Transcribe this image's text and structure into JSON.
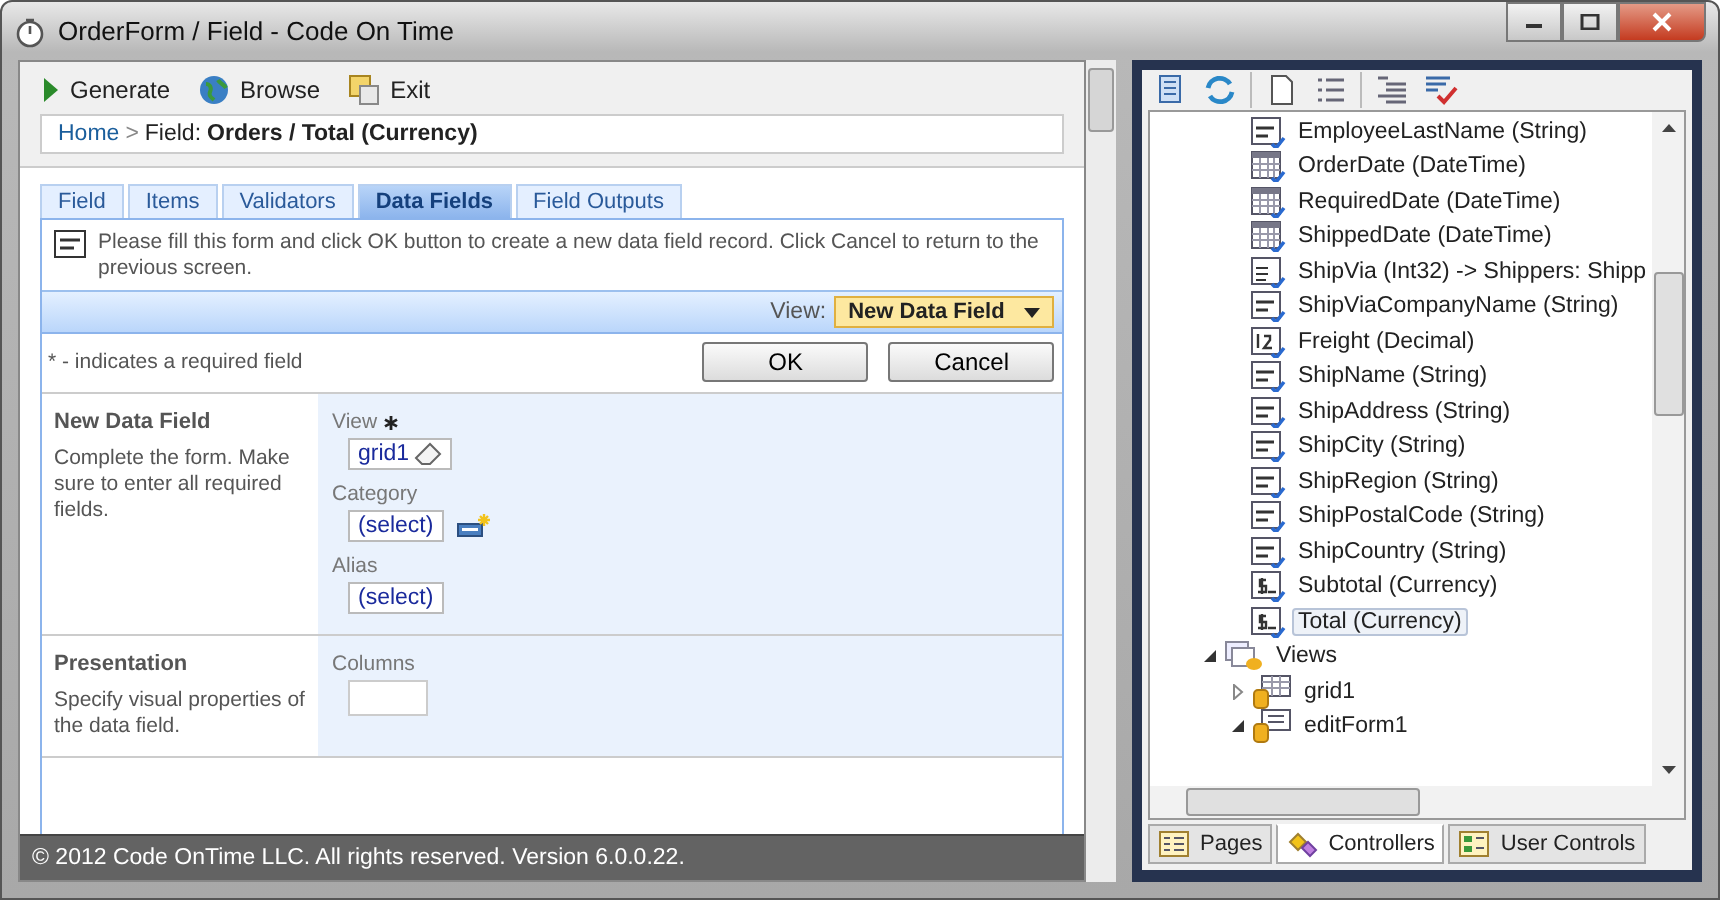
{
  "window": {
    "title": "OrderForm / Field - Code On Time"
  },
  "toolbar": [
    {
      "label": "Generate",
      "kind": "play"
    },
    {
      "label": "Browse",
      "kind": "globe"
    },
    {
      "label": "Exit",
      "kind": "exit"
    }
  ],
  "breadcrumb": {
    "link": "Home",
    "separator": ">",
    "prefix": "Field:",
    "value": "Orders / Total (Currency)"
  },
  "tabs": [
    {
      "label": "Field",
      "selected": false
    },
    {
      "label": "Items",
      "selected": false
    },
    {
      "label": "Validators",
      "selected": false
    },
    {
      "label": "Data Fields",
      "selected": true
    },
    {
      "label": "Field Outputs",
      "selected": false
    }
  ],
  "notice": "Please fill this form and click OK button to create a new data field record. Click Cancel to return to the previous screen.",
  "view_bar": {
    "label": "View:",
    "value": "New Data Field"
  },
  "required_note": "* - indicates a required field",
  "buttons": [
    "OK",
    "Cancel"
  ],
  "sections": [
    {
      "title": "New Data Field",
      "description": "Complete the form. Make sure to enter all required fields.",
      "fields": [
        {
          "label": "View",
          "required": true,
          "kind": "lookup",
          "value": "grid1",
          "clearable": true,
          "creatable": false
        },
        {
          "label": "Category",
          "required": false,
          "kind": "lookup",
          "value": "(select)",
          "clearable": false,
          "creatable": true
        },
        {
          "label": "Alias",
          "required": false,
          "kind": "lookup",
          "value": "(select)",
          "clearable": false,
          "creatable": false
        }
      ]
    },
    {
      "title": "Presentation",
      "description": "Specify visual properties of the data field.",
      "fields": [
        {
          "label": "Columns",
          "required": false,
          "kind": "input"
        }
      ]
    }
  ],
  "footer": "© 2012 Code OnTime LLC. All rights reserved. Version 6.0.0.22.",
  "explorer": {
    "fields": [
      {
        "label": "EmployeeLastName (String)",
        "kind": "string",
        "selected": false
      },
      {
        "label": "OrderDate (DateTime)",
        "kind": "date",
        "selected": false
      },
      {
        "label": "RequiredDate (DateTime)",
        "kind": "date",
        "selected": false
      },
      {
        "label": "ShippedDate (DateTime)",
        "kind": "date",
        "selected": false
      },
      {
        "label": "ShipVia (Int32) -> Shippers: Shipp",
        "kind": "lookup",
        "selected": false
      },
      {
        "label": "ShipViaCompanyName (String)",
        "kind": "string",
        "selected": false
      },
      {
        "label": "Freight (Decimal)",
        "kind": "number",
        "selected": false
      },
      {
        "label": "ShipName (String)",
        "kind": "string",
        "selected": false
      },
      {
        "label": "ShipAddress (String)",
        "kind": "string",
        "selected": false
      },
      {
        "label": "ShipCity (String)",
        "kind": "string",
        "selected": false
      },
      {
        "label": "ShipRegion (String)",
        "kind": "string",
        "selected": false
      },
      {
        "label": "ShipPostalCode (String)",
        "kind": "string",
        "selected": false
      },
      {
        "label": "ShipCountry (String)",
        "kind": "string",
        "selected": false
      },
      {
        "label": "Subtotal (Currency)",
        "kind": "currency",
        "selected": false
      },
      {
        "label": "Total (Currency)",
        "kind": "currency",
        "selected": true
      }
    ],
    "views": {
      "label": "Views",
      "expanded": true,
      "children": [
        {
          "label": "grid1",
          "kind": "grid",
          "expanded": false
        },
        {
          "label": "editForm1",
          "kind": "form",
          "expanded": true
        }
      ]
    },
    "tabs": [
      {
        "label": "Pages",
        "selected": false
      },
      {
        "label": "Controllers",
        "selected": true
      },
      {
        "label": "User Controls",
        "selected": false
      }
    ]
  }
}
